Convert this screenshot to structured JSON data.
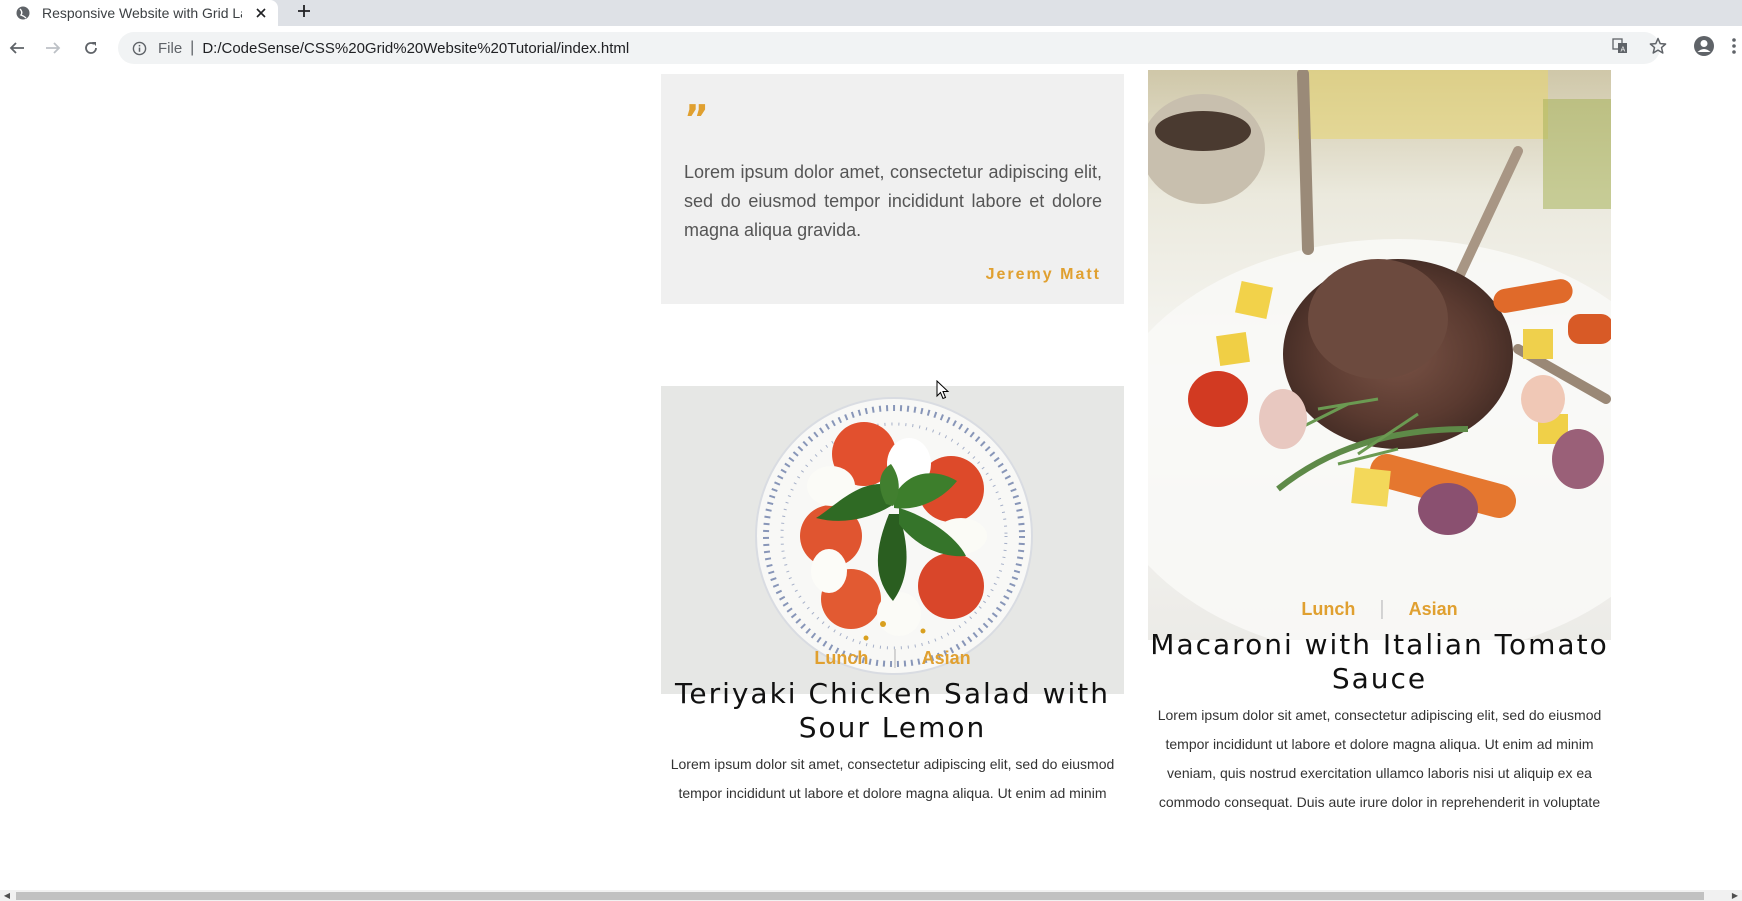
{
  "browser": {
    "tab_title": "Responsive Website with Grid La",
    "scheme_label": "File",
    "separator": "|",
    "url": "D:/CodeSense/CSS%20Grid%20Website%20Tutorial/index.html"
  },
  "testimonial": {
    "quote_mark": "”",
    "text": "Lorem ipsum dolor amet, consectetur adipiscing elit, sed do eiusmod tempor incididunt labore et dolore magna aliqua gravida.",
    "author": "Jeremy Matt"
  },
  "cards": [
    {
      "category": "Lunch",
      "cuisine": "Asian",
      "title": "Teriyaki Chicken Salad with Sour Lemon",
      "description": "Lorem ipsum dolor sit amet, consectetur adipiscing elit, sed do eiusmod tempor incididunt ut labore et dolore magna aliqua. Ut enim ad minim"
    },
    {
      "category": "Lunch",
      "cuisine": "Asian",
      "title": "Macaroni with Italian Tomato Sauce",
      "description": "Lorem ipsum dolor sit amet, consectetur adipiscing elit, sed do eiusmod tempor incididunt ut labore et dolore magna aliqua. Ut enim ad minim veniam, quis nostrud exercitation ullamco laboris nisi ut aliquip ex ea commodo consequat. Duis aute irure dolor in reprehenderit in voluptate"
    }
  ],
  "colors": {
    "accent": "#e0a030",
    "card_bg": "#f0f0f0"
  }
}
